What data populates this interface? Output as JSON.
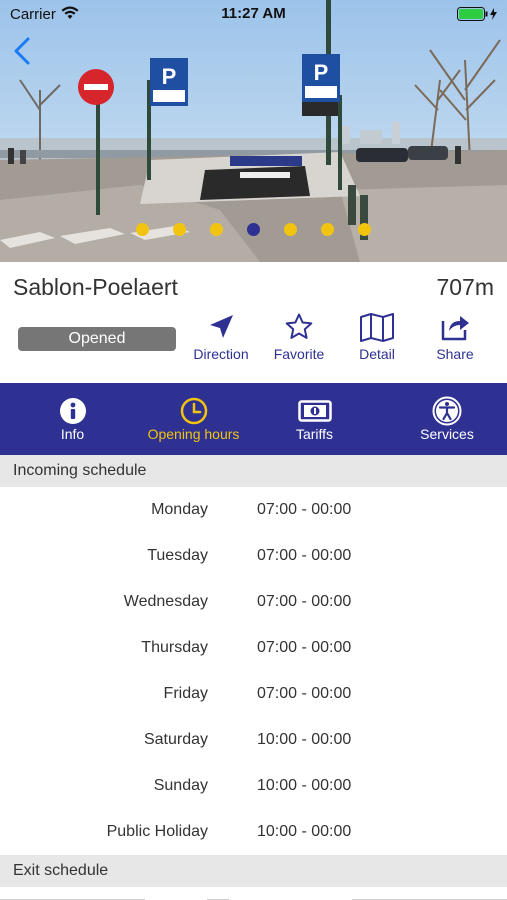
{
  "status_bar": {
    "carrier": "Carrier",
    "time": "11:27 AM"
  },
  "hero": {
    "slide_count": 7,
    "active_slide": 4
  },
  "parking": {
    "name": "Sablon-Poelaert",
    "distance": "707m",
    "status": "Opened"
  },
  "actions": [
    {
      "label": "Direction",
      "icon": "navigation-arrow-icon"
    },
    {
      "label": "Favorite",
      "icon": "star-icon"
    },
    {
      "label": "Detail",
      "icon": "map-icon"
    },
    {
      "label": "Share",
      "icon": "share-icon"
    }
  ],
  "tabs": [
    {
      "label": "Info",
      "icon": "info-icon",
      "active": false
    },
    {
      "label": "Opening hours",
      "icon": "clock-icon",
      "active": true
    },
    {
      "label": "Tariffs",
      "icon": "banknote-icon",
      "active": false
    },
    {
      "label": "Services",
      "icon": "accessibility-icon",
      "active": false
    }
  ],
  "schedule": {
    "incoming_header": "Incoming schedule",
    "exit_header": "Exit schedule",
    "incoming": [
      {
        "day": "Monday",
        "hours": "07:00 - 00:00"
      },
      {
        "day": "Tuesday",
        "hours": "07:00 - 00:00"
      },
      {
        "day": "Wednesday",
        "hours": "07:00 - 00:00"
      },
      {
        "day": "Thursday",
        "hours": "07:00 - 00:00"
      },
      {
        "day": "Friday",
        "hours": "07:00 - 00:00"
      },
      {
        "day": "Saturday",
        "hours": "10:00 - 00:00"
      },
      {
        "day": "Sunday",
        "hours": "10:00 - 00:00"
      },
      {
        "day": "Public Holiday",
        "hours": "10:00 - 00:00"
      }
    ]
  },
  "colors": {
    "brand_blue": "#2e3192",
    "accent_yellow": "#f2c40f",
    "status_grey": "#767676",
    "ios_blue": "#1a7cf5"
  }
}
